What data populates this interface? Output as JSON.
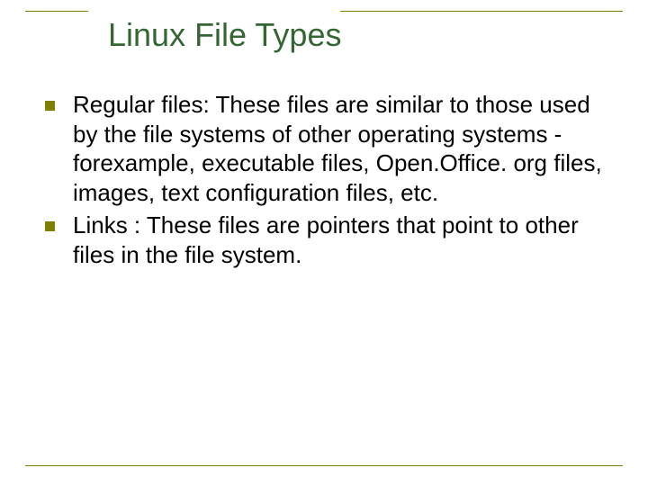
{
  "slide": {
    "title": "Linux File Types",
    "bullets": [
      "Regular files: These files are similar to those used by the file systems of other operating systems - forexample, executable files, Open.Office. org files, images, text configuration files, etc.",
      "Links : These files are pointers that point to other files in the file system."
    ]
  }
}
